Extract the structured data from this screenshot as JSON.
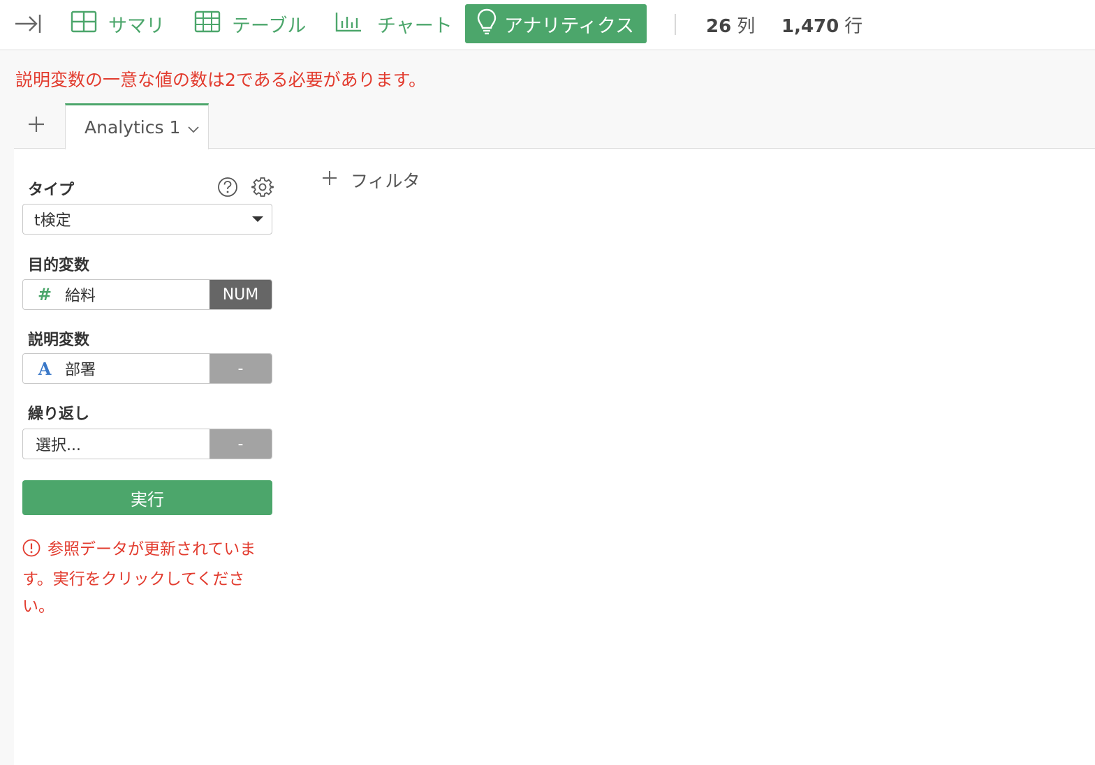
{
  "toolbar": {
    "tabs": [
      {
        "label": "サマリ",
        "icon": "summary-grid-icon"
      },
      {
        "label": "テーブル",
        "icon": "table-icon"
      },
      {
        "label": "チャート",
        "icon": "bar-chart-icon"
      },
      {
        "label": "アナリティクス",
        "icon": "lightbulb-icon",
        "active": true
      }
    ],
    "columns_count": "26",
    "columns_unit": "列",
    "rows_count": "1,470",
    "rows_unit": "行"
  },
  "top_error": "説明変数の一意な値の数は2である必要があります。",
  "analytics_tabs": {
    "active_label": "Analytics 1"
  },
  "panel": {
    "type_label": "タイプ",
    "type_value": "t検定",
    "target_label": "目的変数",
    "target_value": "給料",
    "target_icon": "#",
    "target_badge": "NUM",
    "explanatory_label": "説明変数",
    "explanatory_value": "部署",
    "explanatory_icon": "A",
    "explanatory_badge": "-",
    "repeat_label": "繰り返し",
    "repeat_placeholder": "選択...",
    "repeat_badge": "-",
    "run_label": "実行",
    "warning": "参照データが更新されています。実行をクリックしてください。"
  },
  "filter_label": "フィルタ",
  "colors": {
    "accent": "#4ca66b",
    "error": "#e23b2e",
    "string_type": "#3a78c8"
  }
}
